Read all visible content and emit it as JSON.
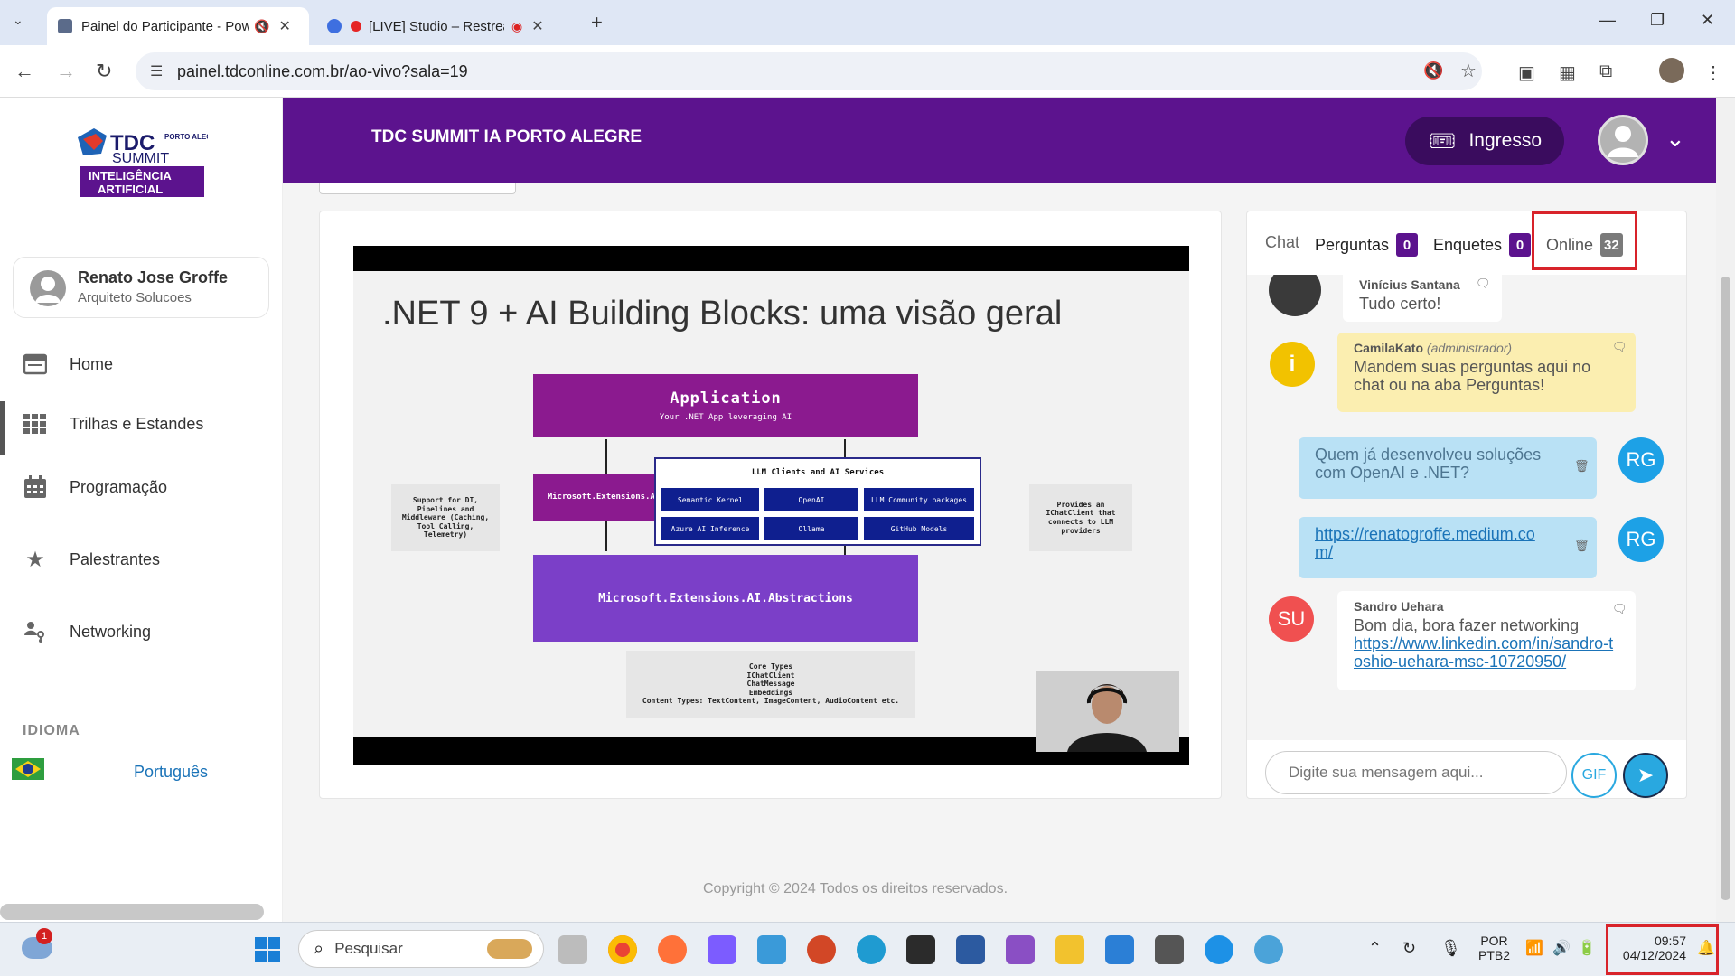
{
  "browser": {
    "tabs": [
      {
        "title": "Painel do Participante - Pow",
        "active": true
      },
      {
        "title": "[LIVE] Studio – Restream",
        "active": false
      }
    ],
    "url": "painel.tdconline.com.br/ao-vivo?sala=19"
  },
  "sidebar": {
    "logo": {
      "line1": "TDC",
      "line2": "SUMMIT",
      "tag": "PORTO ALEGRE",
      "line3": "INTELIGÊNCIA",
      "line4": "ARTIFICIAL"
    },
    "user": {
      "name": "Renato Jose Groffe",
      "role": "Arquiteto Solucoes"
    },
    "items": [
      {
        "label": "Home",
        "icon": "browser-window-icon"
      },
      {
        "label": "Trilhas e Estandes",
        "icon": "grid-icon"
      },
      {
        "label": "Programação",
        "icon": "calendar-icon"
      },
      {
        "label": "Palestrantes",
        "icon": "star-icon"
      },
      {
        "label": "Networking",
        "icon": "people-network-icon"
      }
    ],
    "language_title": "IDIOMA",
    "language_value": "Português"
  },
  "header": {
    "event_title": "TDC SUMMIT IA PORTO ALEGRE",
    "ticket_label": "Ingresso"
  },
  "slide": {
    "title": ".NET 9 + AI Building Blocks: uma visão geral",
    "app_title": "Application",
    "app_sub": "Your .NET App leveraging AI",
    "mea": "Microsoft.Extensions.AI",
    "llm_title": "LLM Clients and AI Services",
    "llm_items": [
      "Semantic Kernel",
      "OpenAI",
      "LLM Community packages",
      "Azure AI Inference",
      "Ollama",
      "GitHub Models"
    ],
    "abstractions": "Microsoft.Extensions.AI.Abstractions",
    "note_left": "Support for DI, Pipelines and Middleware (Caching, Tool Calling, Telemetry)",
    "note_right": "Provides an IChatClient that connects to LLM providers",
    "core_lines": [
      "Core Types",
      "IChatClient",
      "ChatMessage",
      "Embeddings",
      "Content Types: TextContent, ImageContent, AudioContent etc."
    ]
  },
  "chat": {
    "tabs": [
      {
        "label": "Chat",
        "badge": null
      },
      {
        "label": "Perguntas",
        "badge": "0"
      },
      {
        "label": "Enquetes",
        "badge": "0"
      },
      {
        "label": "Online",
        "badge": "32"
      }
    ],
    "messages": [
      {
        "author": "Vinícius Santana",
        "text": "Tudo certo!"
      },
      {
        "author": "CamilaKato",
        "role": "(administrador)",
        "text": "Mandem suas perguntas aqui no chat ou na aba Perguntas!"
      },
      {
        "initials": "RG",
        "text": "Quem já desenvolveu soluções com OpenAI e .NET?"
      },
      {
        "initials": "RG",
        "text": "https://renatogroffe.medium.com/"
      },
      {
        "author": "Sandro Uehara",
        "initials": "SU",
        "text": "Bom dia, bora fazer networking",
        "link": "https://www.linkedin.com/in/sandro-toshio-uehara-msc-10720950/"
      }
    ],
    "input_placeholder": "Digite sua mensagem aqui...",
    "gif_label": "GIF"
  },
  "footer": {
    "copyright": "Copyright © 2024 Todos os direitos reservados."
  },
  "taskbar": {
    "search_placeholder": "Pesquisar",
    "weather_badge": "1",
    "lang_top": "POR",
    "lang_bottom": "PTB2",
    "time": "09:57",
    "date": "04/12/2024"
  },
  "colors": {
    "header": "#5c138e",
    "badge": "#5c138e",
    "accent": "#29a8e0",
    "highlight": "#d8232a"
  }
}
